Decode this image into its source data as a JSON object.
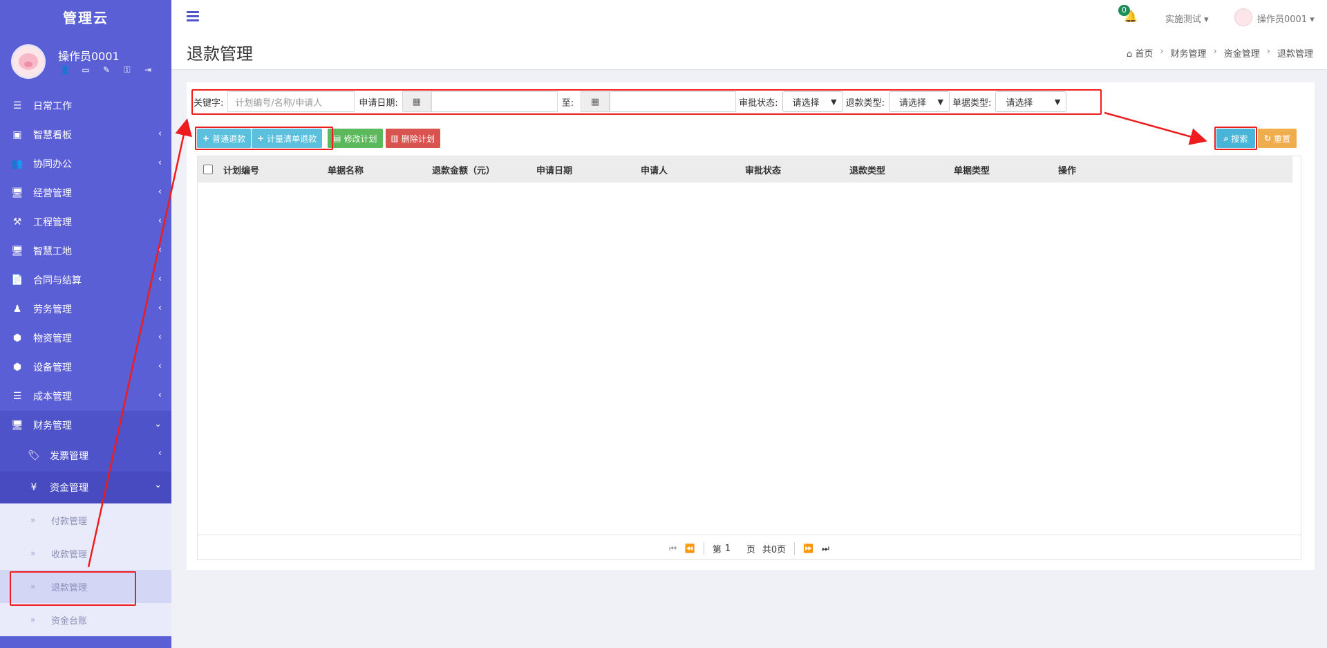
{
  "sidebar": {
    "brand": "管理云",
    "user_name": "操作员0001",
    "menu": [
      {
        "label": "日常工作",
        "icon": "list-icon",
        "glyph": "☰",
        "chev": ""
      },
      {
        "label": "智慧看板",
        "icon": "dashboard-icon",
        "glyph": "▣",
        "chev": "‹"
      },
      {
        "label": "协同办公",
        "icon": "users-icon",
        "glyph": "👥",
        "chev": "‹"
      },
      {
        "label": "经营管理",
        "icon": "desktop-icon",
        "glyph": "🖥",
        "chev": "‹"
      },
      {
        "label": "工程管理",
        "icon": "gavel-icon",
        "glyph": "⚒",
        "chev": "‹"
      },
      {
        "label": "智慧工地",
        "icon": "monitor-icon",
        "glyph": "🖥",
        "chev": "‹"
      },
      {
        "label": "合同与结算",
        "icon": "file-icon",
        "glyph": "📄",
        "chev": "‹"
      },
      {
        "label": "劳务管理",
        "icon": "worker-icon",
        "glyph": "♟",
        "chev": "‹"
      },
      {
        "label": "物资管理",
        "icon": "cube-icon",
        "glyph": "⬢",
        "chev": "‹"
      },
      {
        "label": "设备管理",
        "icon": "cubes-icon",
        "glyph": "⬢",
        "chev": "‹"
      },
      {
        "label": "成本管理",
        "icon": "list-ul-icon",
        "glyph": "☰",
        "chev": "‹"
      },
      {
        "label": "财务管理",
        "icon": "finance-desktop-icon",
        "glyph": "🖥",
        "chev": "⌄"
      }
    ],
    "finance_sub": [
      {
        "label": "发票管理",
        "icon": "tags-icon",
        "glyph": "🏷",
        "chev": "‹"
      },
      {
        "label": "资金管理",
        "icon": "yen-icon",
        "glyph": "¥",
        "chev": "⌄"
      }
    ],
    "fund_sub": [
      "付款管理",
      "收款管理",
      "退款管理",
      "资金台账"
    ]
  },
  "topbar": {
    "notification_count": "0",
    "env_label": "实施测试",
    "user_label": "操作员0001"
  },
  "header": {
    "title": "退款管理",
    "breadcrumb": [
      "首页",
      "财务管理",
      "资金管理",
      "退款管理"
    ]
  },
  "search": {
    "keyword_label": "关键字:",
    "keyword_placeholder": "计划编号/名称/申请人",
    "date_label": "申请日期:",
    "to_label": "至:",
    "status_label": "审批状态:",
    "refund_type_label": "退款类型:",
    "doc_type_label": "单据类型:",
    "select_default": "请选择"
  },
  "toolbar": {
    "normal_refund": "普通退款",
    "billing_refund": "计量清单退款",
    "edit_plan": "修改计划",
    "delete_plan": "删除计划",
    "search": "搜索",
    "reset": "重置"
  },
  "table": {
    "columns": [
      "计划编号",
      "单据名称",
      "退款金额（元）",
      "申请日期",
      "申请人",
      "审批状态",
      "退款类型",
      "单据类型",
      "操作"
    ],
    "rows": []
  },
  "pager": {
    "page_prefix": "第",
    "page_value": "1",
    "page_suffix": "页",
    "total": "共0页"
  },
  "colors": {
    "sidebar": "#5b5fd6",
    "info": "#5bc0de",
    "success": "#5cb85c",
    "danger": "#d9534f",
    "warning": "#f0ad4e",
    "annotation": "#ee1c1c"
  }
}
